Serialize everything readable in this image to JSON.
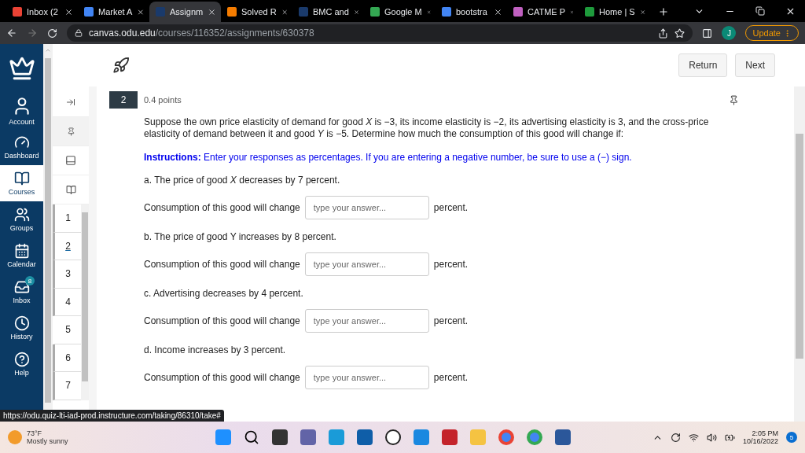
{
  "browser": {
    "tabs": [
      {
        "label": "Inbox (2",
        "selected": false,
        "color": "#ea4335"
      },
      {
        "label": "Market A",
        "selected": false,
        "color": "#4285f4"
      },
      {
        "label": "Assignm",
        "selected": true,
        "color": "#1a3a6b"
      },
      {
        "label": "Solved R",
        "selected": false,
        "color": "#f57c00"
      },
      {
        "label": "BMC and",
        "selected": false,
        "color": "#1a3a6b"
      },
      {
        "label": "Google M",
        "selected": false,
        "color": "#34a853"
      },
      {
        "label": "bootstra",
        "selected": false,
        "color": "#4285f4"
      },
      {
        "label": "CATME P",
        "selected": false,
        "color": "#c060c0"
      },
      {
        "label": "Home | S",
        "selected": false,
        "color": "#1e9b3c"
      }
    ],
    "url_host": "canvas.odu.edu",
    "url_path": "/courses/116352/assignments/630378",
    "profile": "J",
    "update": "Update"
  },
  "sidebar": {
    "items": [
      {
        "label": "Account",
        "kind": "account",
        "selected": false
      },
      {
        "label": "Dashboard",
        "kind": "dashboard",
        "selected": false
      },
      {
        "label": "Courses",
        "kind": "courses",
        "selected": true
      },
      {
        "label": "Groups",
        "kind": "groups",
        "selected": false
      },
      {
        "label": "Calendar",
        "kind": "calendar",
        "selected": false
      },
      {
        "label": "Inbox",
        "kind": "inbox",
        "selected": false,
        "badge": "8"
      },
      {
        "label": "History",
        "kind": "history",
        "selected": false
      },
      {
        "label": "Help",
        "kind": "help",
        "selected": false
      }
    ]
  },
  "question_nav": [
    {
      "label": "1",
      "selected": false,
      "marked": true
    },
    {
      "label": "2",
      "selected": true,
      "marked": true
    },
    {
      "label": "3",
      "selected": false,
      "marked": true
    },
    {
      "label": "4",
      "selected": false,
      "marked": true
    },
    {
      "label": "5",
      "selected": false,
      "marked": false
    },
    {
      "label": "6",
      "selected": false,
      "marked": true
    },
    {
      "label": "7",
      "selected": false,
      "marked": true
    }
  ],
  "top_buttons": [
    "Return",
    "Next"
  ],
  "question": {
    "number": "2",
    "points": "0.4 points",
    "text": "Suppose the own price elasticity of demand for good *X* is −3, its income elasticity is −2, its advertising elasticity is 3, and the cross-price elasticity of demand between it and good *Y* is −5. Determine how much the consumption of this good will change if:",
    "instructions": "**Instructions:** Enter your responses as percentages. If you are entering a negative number, be sure to use a (−) sign.",
    "parts": [
      {
        "prompt": "a. The price of good *X* decreases by 7 percent.",
        "lead": "Consumption of this good will change",
        "placeholder": "type your answer...",
        "unit": "percent."
      },
      {
        "prompt": "b. The price of good Y increases by 8 percent.",
        "lead": "Consumption of this good will change",
        "placeholder": "type your answer...",
        "unit": "percent."
      },
      {
        "prompt": "c. Advertising decreases by 4 percent.",
        "lead": "Consumption of this good will change",
        "placeholder": "type your answer...",
        "unit": "percent."
      },
      {
        "prompt": "d. Income increases by 3 percent.",
        "lead": "Consumption of this good will change",
        "placeholder": "type your answer...",
        "unit": "percent."
      }
    ]
  },
  "status_url": "https://odu.quiz-lti-iad-prod.instructure.com/taking/86310/take#",
  "taskbar": {
    "weather_temp": "73°F",
    "weather_text": "Mostly sunny",
    "time": "2:05 PM",
    "date": "10/16/2022",
    "notifications": "5"
  }
}
